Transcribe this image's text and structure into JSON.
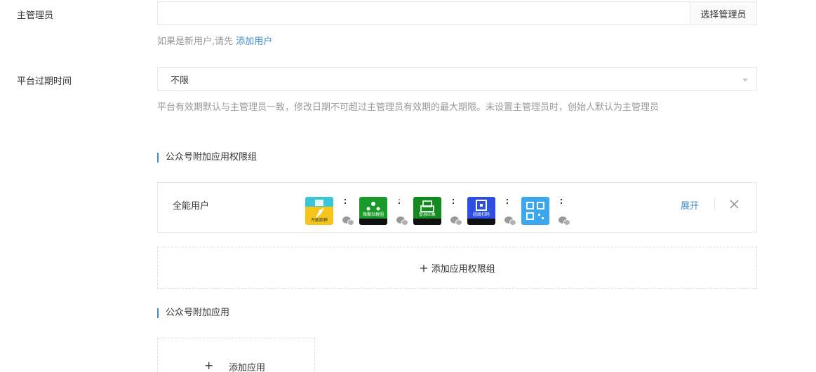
{
  "admin": {
    "label": "主管理员",
    "input_value": "",
    "input_placeholder": "",
    "select_button": "选择管理员",
    "hint_prefix": "如果是新用户,请先 ",
    "hint_link": "添加用户"
  },
  "expire": {
    "label": "平台过期时间",
    "selected": "不限",
    "hint": "平台有效期默认与主管理员一致，修改日期不可超过主管理员有效期的最大期限。未设置主管理员时，创始人默认为主管理员"
  },
  "perm_groups": {
    "title": "公众号附加应用权限组",
    "groups": [
      {
        "name": "全能用户",
        "apps": [
          {
            "icon": "wanneng-app-icon",
            "caption": "万能跑神",
            "color": "#f5c518"
          },
          {
            "icon": "weiju-app-icon",
            "caption": "微聚社群圈",
            "color": "#1a9a2a"
          },
          {
            "icon": "print-app-icon",
            "caption": "智慧印象",
            "color": "#138a1f"
          },
          {
            "icon": "scan-app-icon",
            "caption": "超级扫码",
            "color": "#2d4ee0"
          },
          {
            "icon": "qrcode-app-icon",
            "caption": "",
            "color": "#3aa7ee"
          }
        ],
        "expand_label": "展开"
      }
    ],
    "add_label": "添加应用权限组"
  },
  "addon_apps": {
    "title": "公众号附加应用",
    "add_label": "添加应用"
  }
}
